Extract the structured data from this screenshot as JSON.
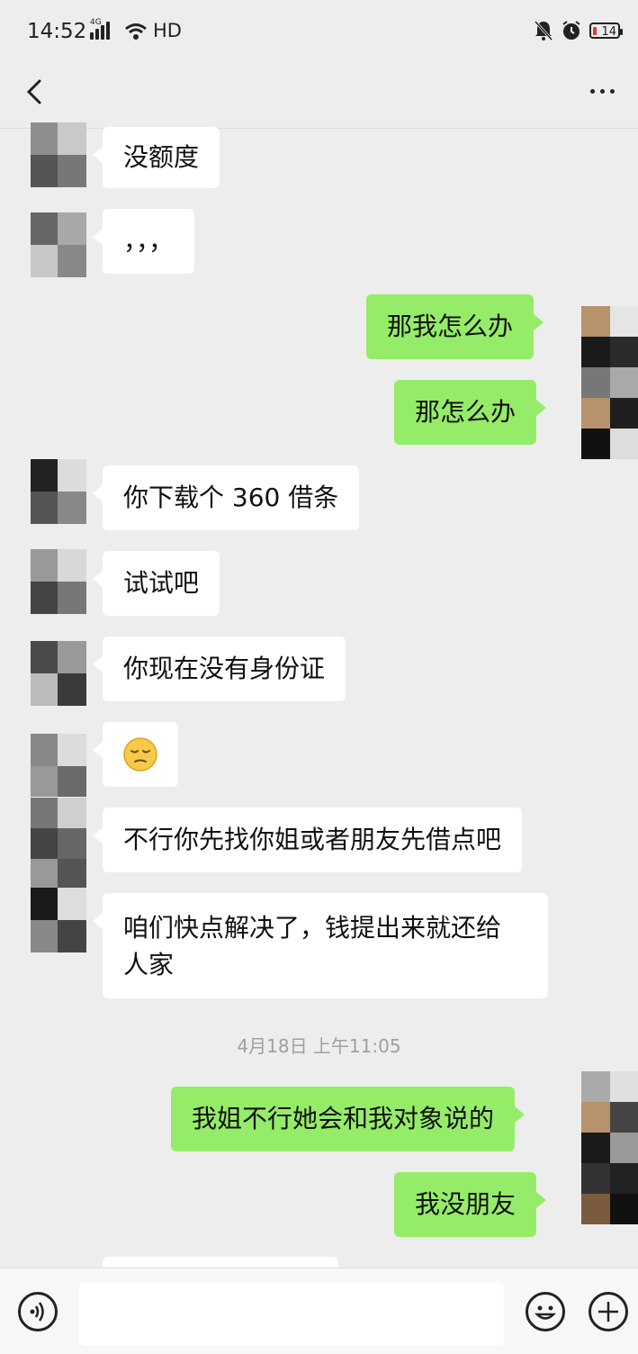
{
  "status_bar": {
    "time": "14:52",
    "network": "4G",
    "hd": "HD",
    "battery": "14",
    "battery_color": "#e53935"
  },
  "nav": {
    "back_icon": "chevron-left-icon",
    "more_icon": "more-dots-icon"
  },
  "messages": [
    {
      "side": "in",
      "text": "没额度"
    },
    {
      "side": "in",
      "text": "，，，"
    },
    {
      "side": "out",
      "text": "那我怎么办"
    },
    {
      "side": "out",
      "text": "那怎么办"
    },
    {
      "side": "in",
      "text": "你下载个 360 借条"
    },
    {
      "side": "in",
      "text": "试试吧"
    },
    {
      "side": "in",
      "text": "你现在没有身份证"
    },
    {
      "side": "in",
      "text": "😔"
    },
    {
      "side": "in",
      "text": "不行你先找你姐或者朋友先借点吧"
    },
    {
      "side": "in",
      "text_line1": "咱们快点解决了，钱提出来就还给",
      "text_line2": "人家"
    },
    {
      "side": "out",
      "text": "我姐不行她会和我对象说的"
    },
    {
      "side": "out",
      "text": "我没朋友"
    }
  ],
  "timestamp": "4月18日 上午11:05",
  "input_bar": {
    "voice_icon": "voice-icon",
    "emoji_icon": "emoji-icon",
    "add_icon": "plus-icon",
    "text_value": ""
  },
  "colors": {
    "background": "#ededed",
    "incoming_bubble": "#ffffff",
    "outgoing_bubble": "#95ec69"
  }
}
